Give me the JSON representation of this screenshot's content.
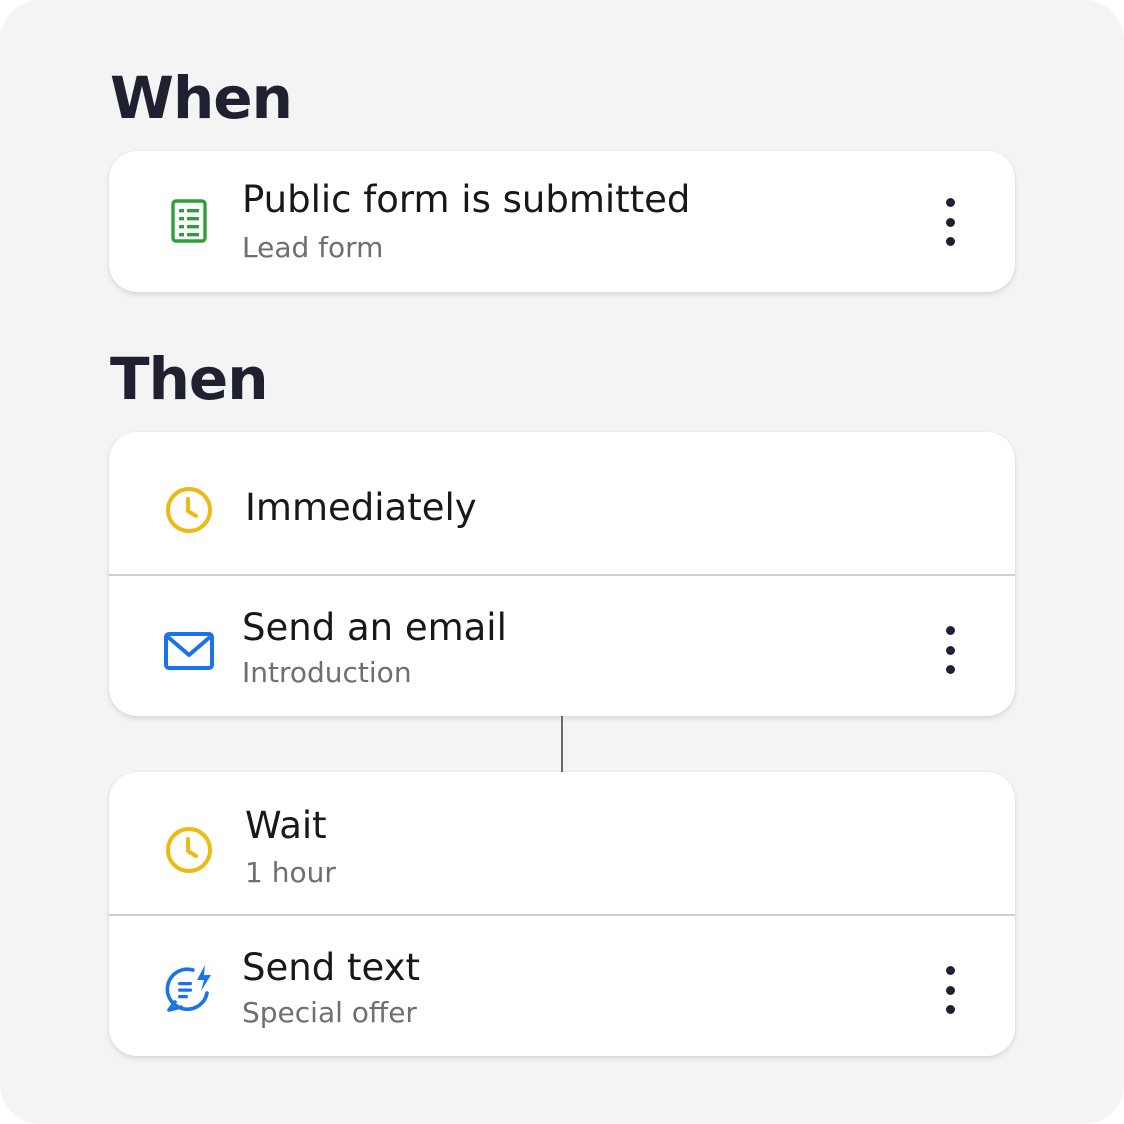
{
  "colors": {
    "background": "#f4f4f4",
    "card": "#ffffff",
    "form_icon": "#2e9e3b",
    "clock_icon": "#ebbb14",
    "email_icon": "#1a73e8",
    "text_icon": "#1a73e8"
  },
  "when": {
    "heading": "When",
    "trigger": {
      "icon": "form-icon",
      "title": "Public form is submitted",
      "subtitle": "Lead form"
    }
  },
  "then": {
    "heading": "Then",
    "steps": [
      {
        "timing": {
          "icon": "clock-icon",
          "title": "Immediately"
        },
        "action": {
          "icon": "mail-icon",
          "title": "Send an email",
          "subtitle": "Introduction"
        }
      },
      {
        "timing": {
          "icon": "clock-icon",
          "title": "Wait",
          "subtitle": "1 hour"
        },
        "action": {
          "icon": "text-message-icon",
          "title": "Send text",
          "subtitle": "Special offer"
        }
      }
    ]
  }
}
